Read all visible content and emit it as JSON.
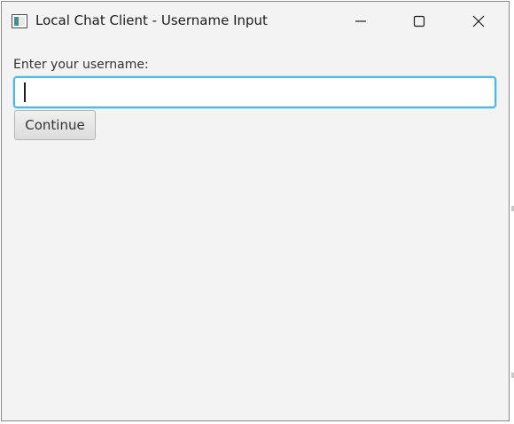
{
  "window": {
    "title": "Local Chat Client - Username Input",
    "controls": {
      "minimize_icon": "minimize-icon",
      "maximize_icon": "maximize-icon",
      "close_icon": "close-icon"
    }
  },
  "form": {
    "prompt_label": "Enter your username:",
    "username_value": "",
    "username_placeholder": "",
    "continue_label": "Continue"
  },
  "colors": {
    "window_background": "#f3f3f3",
    "input_focus_border": "#4fb8e2",
    "text": "#333333"
  }
}
